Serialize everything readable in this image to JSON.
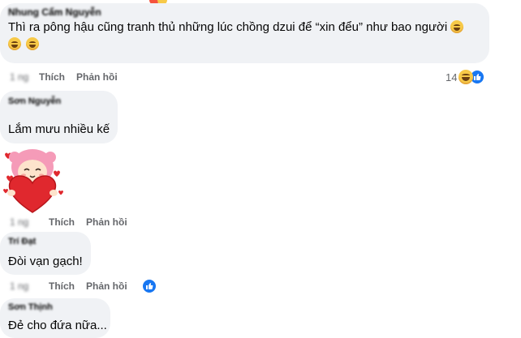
{
  "comments": [
    {
      "author": "Nhung Cẩm Nguyễn",
      "text_line1": "Thì ra pông hậu cũng tranh thủ những lúc chồng dzui để “xin đểu” như bao người",
      "time": "1 ng",
      "like_label": "Thích",
      "reply_label": "Phản hồi",
      "reaction_count": "14"
    },
    {
      "author": "Sơn Nguyễn",
      "text": "Lắm mưu nhiều kế",
      "sticker": "girl-holding-heart-sticker",
      "time": "1 ng",
      "like_label": "Thích",
      "reply_label": "Phản hồi"
    },
    {
      "author": "Trí Đạt",
      "text": "Đòi vạn gạch!",
      "time": "1 ng",
      "like_label": "Thích",
      "reply_label": "Phản hồi"
    },
    {
      "author": "Sơn Thịnh",
      "text": "Đẻ cho đứa nữa..."
    }
  ],
  "colors": {
    "bubble": "#f0f2f5",
    "meta_text": "#65676b",
    "like_blue": "#1877f2",
    "emoji_yellow": "#f7c948",
    "heart_red": "#e0282e"
  }
}
